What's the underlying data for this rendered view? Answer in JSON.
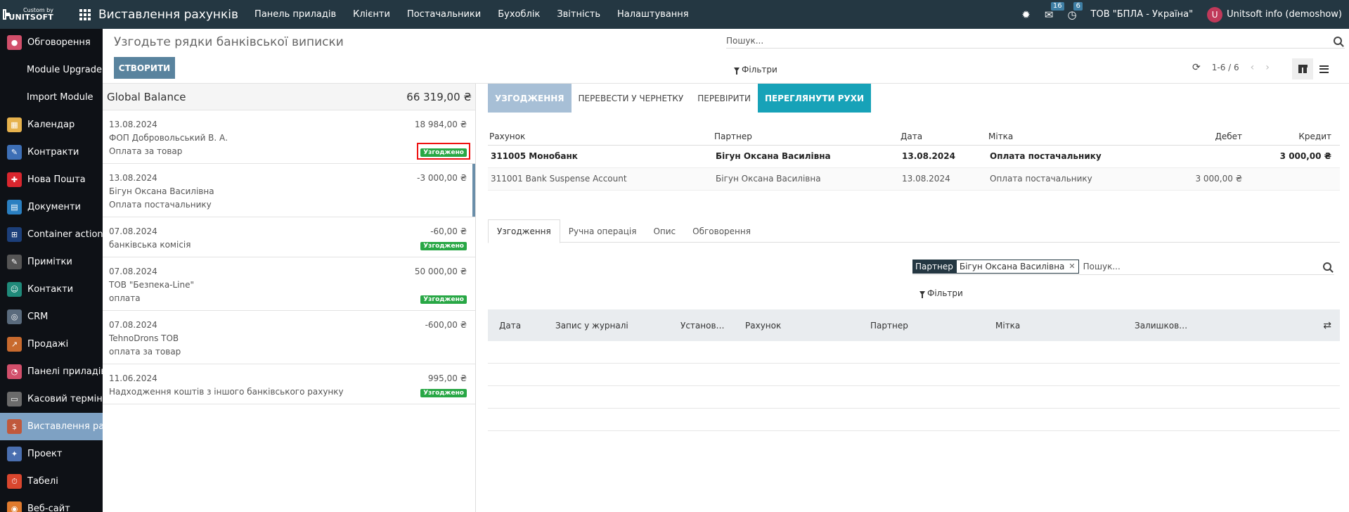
{
  "navbar": {
    "brand_small": "Custom by",
    "brand_big": "UNITSOFT",
    "app_title": "Виставлення рахунків",
    "menu": [
      "Панель приладів",
      "Клієнти",
      "Постачальники",
      "Бухоблік",
      "Звітність",
      "Налаштування"
    ],
    "messages_count": "16",
    "activities_count": "6",
    "company": "ТОВ \"БПЛА - Україна\"",
    "user_initial": "U",
    "user_name": "Unitsoft info (demoshow)"
  },
  "sidebar": {
    "items": [
      {
        "label": "Обговорення",
        "icon": "chat-icon",
        "color": "#d24f6b",
        "glyph": "●"
      },
      {
        "label": "Module Upgrade",
        "icon": "",
        "color": "",
        "glyph": ""
      },
      {
        "label": "Import Module",
        "icon": "",
        "color": "",
        "glyph": ""
      },
      {
        "label": "Календар",
        "icon": "calendar-icon",
        "color": "#e6b24d",
        "glyph": "▦"
      },
      {
        "label": "Контракти",
        "icon": "contract-icon",
        "color": "#3d6fb6",
        "glyph": "✎"
      },
      {
        "label": "Нова Пошта",
        "icon": "nova-poshta-icon",
        "color": "#d9262e",
        "glyph": "✚"
      },
      {
        "label": "Документи",
        "icon": "documents-icon",
        "color": "#2a7fc1",
        "glyph": "▤"
      },
      {
        "label": "Container actions",
        "icon": "container-icon",
        "color": "#1c3f7a",
        "glyph": "⊞"
      },
      {
        "label": "Примітки",
        "icon": "notes-icon",
        "color": "#555555",
        "glyph": "✎"
      },
      {
        "label": "Контакти",
        "icon": "contacts-icon",
        "color": "#1f8a7a",
        "glyph": "☺"
      },
      {
        "label": "CRM",
        "icon": "crm-icon",
        "color": "#5a6b7d",
        "glyph": "◎"
      },
      {
        "label": "Продажі",
        "icon": "sales-icon",
        "color": "#c86a2e",
        "glyph": "↗"
      },
      {
        "label": "Панелі приладів",
        "icon": "dashboard-icon",
        "color": "#d24f6b",
        "glyph": "◔"
      },
      {
        "label": "Касовий термін…",
        "icon": "pos-icon",
        "color": "#6b6b6b",
        "glyph": "▭"
      },
      {
        "label": "Виставлення ра…",
        "icon": "invoicing-icon",
        "color": "#c0593c",
        "glyph": "$"
      },
      {
        "label": "Проект",
        "icon": "project-icon",
        "color": "#4a6fb0",
        "glyph": "✦"
      },
      {
        "label": "Табелі",
        "icon": "timesheet-icon",
        "color": "#d9462e",
        "glyph": "⏱"
      },
      {
        "label": "Веб-сайт",
        "icon": "website-icon",
        "color": "#e07b2e",
        "glyph": "◉"
      }
    ],
    "active_index": 14
  },
  "control": {
    "title": "Узгодьте рядки банківської виписки",
    "create_label": "СТВОРИТИ",
    "search_placeholder": "Пошук...",
    "filters_label": "Фільтри",
    "pager": "1-6 / 6"
  },
  "statements": {
    "global_label": "Global Balance",
    "global_amount": "66 319,00 ₴",
    "items": [
      {
        "date": "13.08.2024",
        "amount": "18 984,00 ₴",
        "partner": "ФОП Добровольський В. А.",
        "ref": "Оплата за товар",
        "status": "Узгоджено"
      },
      {
        "date": "13.08.2024",
        "amount": "-3 000,00 ₴",
        "partner": "Бігун Оксана Василівна",
        "ref": "Оплата постачальнику",
        "status": ""
      },
      {
        "date": "07.08.2024",
        "amount": "-60,00 ₴",
        "partner": "",
        "ref": "банківська комісія",
        "status": "Узгоджено"
      },
      {
        "date": "07.08.2024",
        "amount": "50 000,00 ₴",
        "partner": "ТОВ \"Безпека-Line\"",
        "ref": "оплата",
        "status": "Узгоджено"
      },
      {
        "date": "07.08.2024",
        "amount": "-600,00 ₴",
        "partner": "TehnoDrons ТОВ",
        "ref": "оплата за товар",
        "status": ""
      },
      {
        "date": "11.06.2024",
        "amount": "995,00 ₴",
        "partner": "",
        "ref": "Надходження коштів з іншого банківського рахунку",
        "status": "Узгоджено"
      }
    ]
  },
  "reconcile": {
    "actions": [
      "УЗГОДЖЕННЯ",
      "ПЕРЕВЕСТИ У ЧЕРНЕТКУ",
      "ПЕРЕВІРИТИ",
      "ПЕРЕГЛЯНУТИ РУХИ"
    ],
    "columns": {
      "account": "Рахунок",
      "partner": "Партнер",
      "date": "Дата",
      "label": "Мітка",
      "debit": "Дебет",
      "credit": "Кредит"
    },
    "lines": [
      {
        "account": "311005 Монобанк",
        "partner": "Бігун Оксана Василівна",
        "date": "13.08.2024",
        "label": "Оплата постачальнику",
        "debit": "",
        "credit": "3 000,00 ₴"
      },
      {
        "account": "311001 Bank Suspense Account",
        "partner": "Бігун Оксана Василівна",
        "date": "13.08.2024",
        "label": "Оплата постачальнику",
        "debit": "3 000,00 ₴",
        "credit": ""
      }
    ],
    "tabs": [
      "Узгодження",
      "Ручна операція",
      "Опис",
      "Обговорення"
    ],
    "facet_label": "Партнер",
    "facet_value": "Бігун Оксана Василівна",
    "search_placeholder": "Пошук...",
    "filters_label": "Фільтри",
    "moves_columns": [
      "Дата",
      "Запис у журналі",
      "Установ…",
      "Рахунок",
      "Партнер",
      "Мітка",
      "Залишков…"
    ]
  }
}
